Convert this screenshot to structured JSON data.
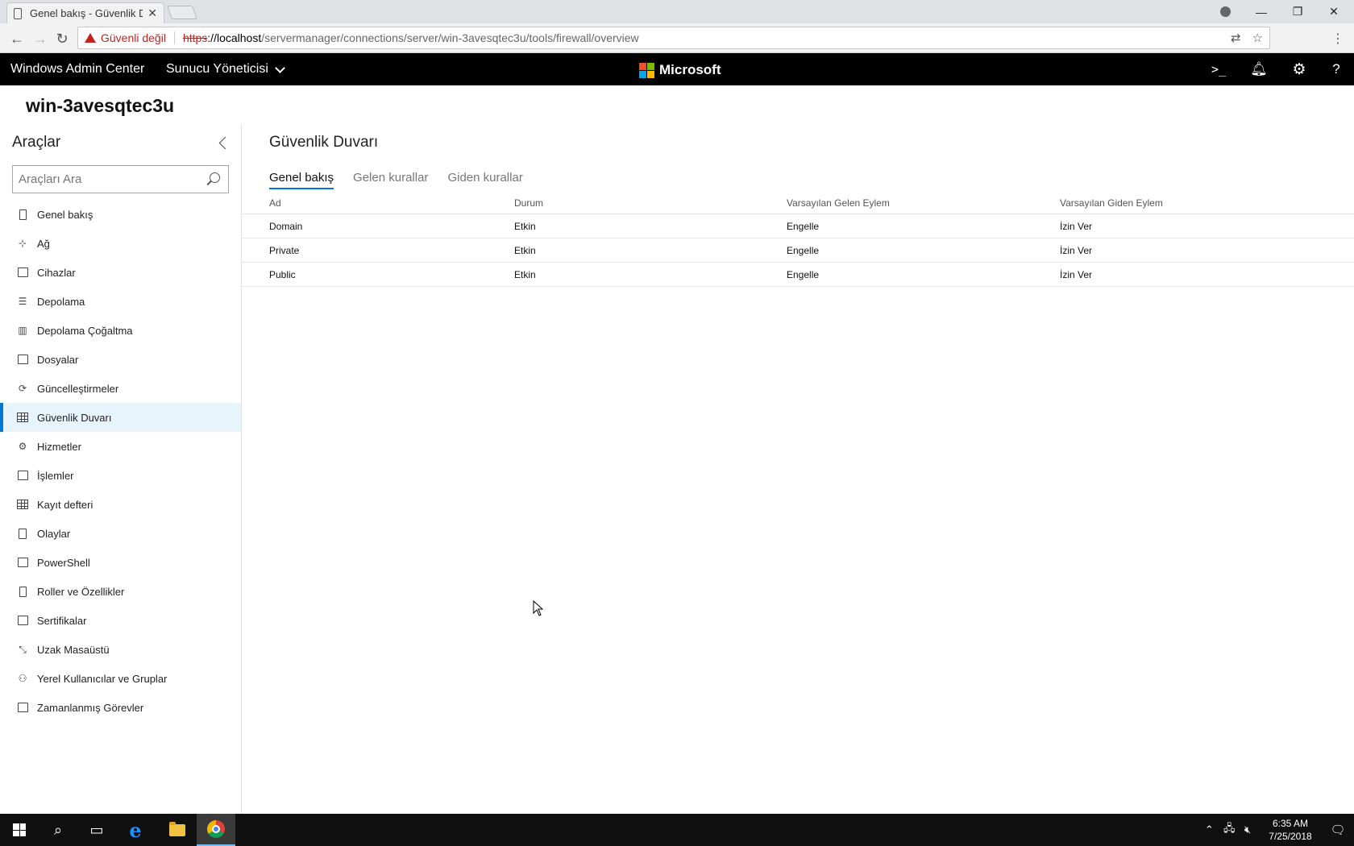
{
  "browser": {
    "tab_title": "Genel bakış - Güvenlik Du",
    "tab_close": "✕",
    "security_label": "Güvenli değil",
    "url_scheme": "https",
    "url_host": "://localhost",
    "url_path": "/servermanager/connections/server/win-3avesqtec3u/tools/firewall/overview"
  },
  "header": {
    "app_title": "Windows Admin Center",
    "manager_label": "Sunucu Yöneticisi",
    "brand": "Microsoft",
    "help": "?"
  },
  "server": {
    "name": "win-3avesqtec3u"
  },
  "sidebar": {
    "title": "Araçlar",
    "search_placeholder": "Araçları Ara",
    "items": [
      {
        "label": "Genel bakış",
        "icon": "server-icon"
      },
      {
        "label": "Ağ",
        "icon": "network-icon"
      },
      {
        "label": "Cihazlar",
        "icon": "devices-icon"
      },
      {
        "label": "Depolama",
        "icon": "storage-icon"
      },
      {
        "label": "Depolama Çoğaltma",
        "icon": "storage-replica-icon"
      },
      {
        "label": "Dosyalar",
        "icon": "files-icon"
      },
      {
        "label": "Güncelleştirmeler",
        "icon": "updates-icon"
      },
      {
        "label": "Güvenlik Duvarı",
        "icon": "firewall-icon"
      },
      {
        "label": "Hizmetler",
        "icon": "services-icon"
      },
      {
        "label": "İşlemler",
        "icon": "processes-icon"
      },
      {
        "label": "Kayıt defteri",
        "icon": "registry-icon"
      },
      {
        "label": "Olaylar",
        "icon": "events-icon"
      },
      {
        "label": "PowerShell",
        "icon": "powershell-icon"
      },
      {
        "label": "Roller ve Özellikler",
        "icon": "roles-icon"
      },
      {
        "label": "Sertifikalar",
        "icon": "certificates-icon"
      },
      {
        "label": "Uzak Masaüstü",
        "icon": "remote-desktop-icon"
      },
      {
        "label": "Yerel Kullanıcılar ve Gruplar",
        "icon": "users-icon"
      },
      {
        "label": "Zamanlanmış Görevler",
        "icon": "scheduled-tasks-icon"
      }
    ],
    "active_index": 7
  },
  "main": {
    "title": "Güvenlik Duvarı",
    "tabs": [
      {
        "label": "Genel bakış",
        "active": true
      },
      {
        "label": "Gelen kurallar",
        "active": false
      },
      {
        "label": "Giden kurallar",
        "active": false
      }
    ],
    "table": {
      "columns": [
        "Ad",
        "Durum",
        "Varsayılan Gelen Eylem",
        "Varsayılan Giden Eylem"
      ],
      "rows": [
        [
          "Domain",
          "Etkin",
          "Engelle",
          "İzin Ver"
        ],
        [
          "Private",
          "Etkin",
          "Engelle",
          "İzin Ver"
        ],
        [
          "Public",
          "Etkin",
          "Engelle",
          "İzin Ver"
        ]
      ]
    }
  },
  "taskbar": {
    "time": "6:35 AM",
    "date": "7/25/2018",
    "ie_label": "e"
  },
  "colors": {
    "accent": "#0078d4",
    "active_item_bg": "#e8f4fb",
    "warning": "#c5221f",
    "header_bg": "#000000"
  }
}
